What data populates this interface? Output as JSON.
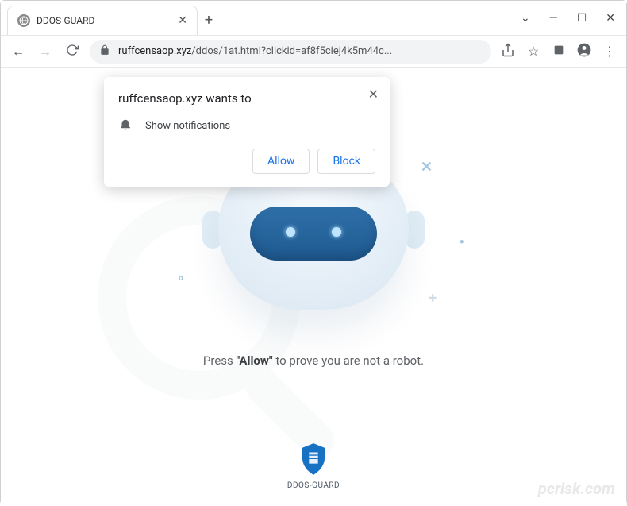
{
  "window": {
    "tab_title": "DDOS-GUARD",
    "caret_down": "⌄",
    "minimize": "—",
    "maximize": "☐",
    "close": "✕"
  },
  "toolbar": {
    "url_host": "ruffcensaop.xyz",
    "url_path": "/ddos/1at.html?clickid=af8f5ciej4k5m44c..."
  },
  "notification": {
    "title_prefix": "ruffcensaop.xyz wants to",
    "permission_text": "Show notifications",
    "allow_label": "Allow",
    "block_label": "Block"
  },
  "page": {
    "prompt_pre": "Press ",
    "prompt_bold": "\"Allow\"",
    "prompt_post": " to prove you are not a robot.",
    "footer_label": "DDOS-GUARD"
  },
  "watermark": "pcrisk.com"
}
